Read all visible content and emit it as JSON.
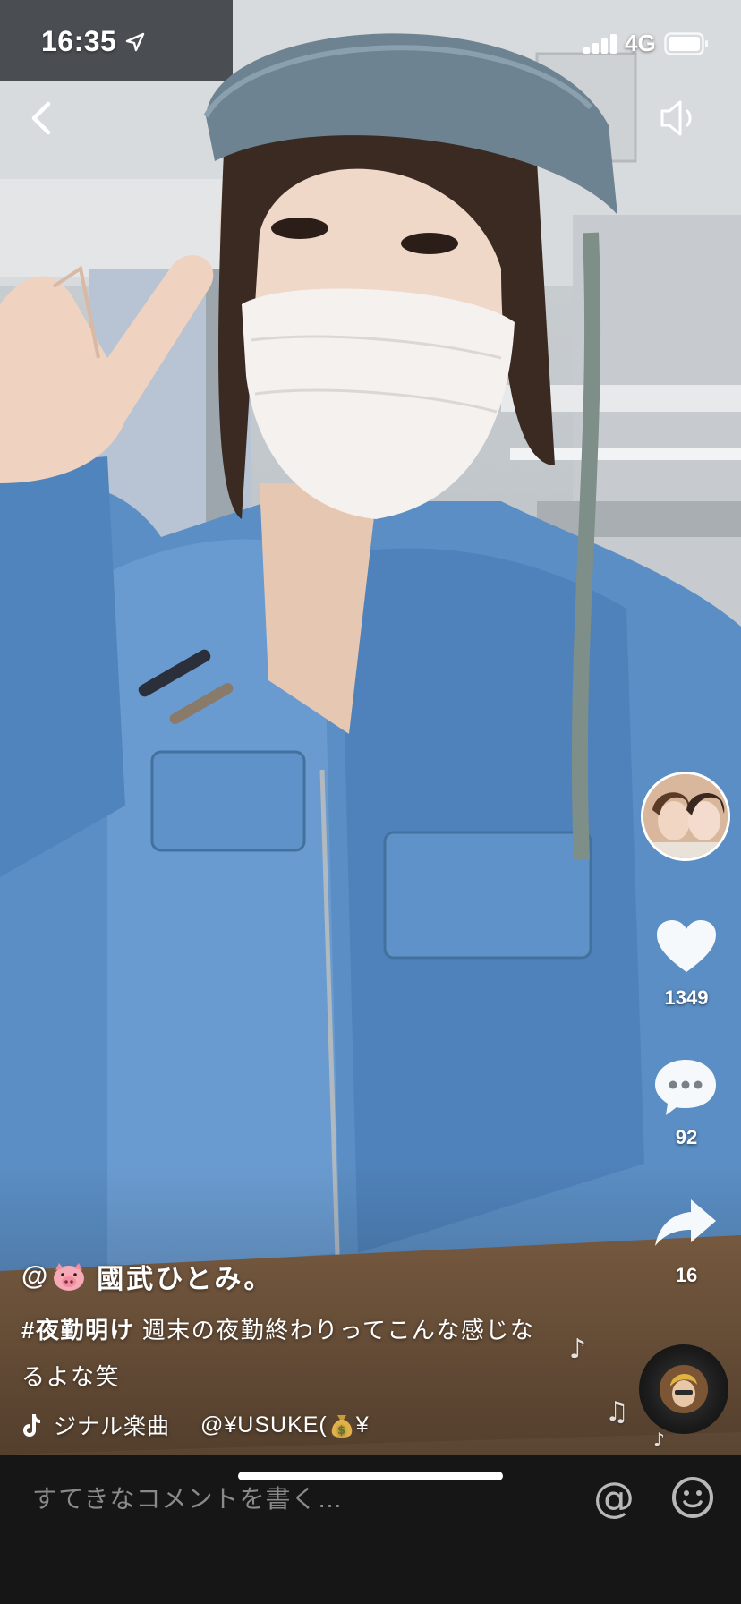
{
  "status_bar": {
    "time": "16:35",
    "network": "4G",
    "icons": [
      "location-arrow-icon",
      "cellular-signal-icon",
      "battery-icon"
    ]
  },
  "top_bar": {
    "icons": [
      "back-chevron-icon",
      "speaker-icon"
    ]
  },
  "actions": {
    "likes": "1349",
    "comments": "92",
    "shares": "16",
    "icons": [
      "heart-icon",
      "comment-bubble-icon",
      "share-arrow-icon"
    ]
  },
  "caption": {
    "at_sign": "@",
    "username": "國武ひとみ。",
    "hashtag": "#夜勤明け",
    "text_line1": "週末の夜勤終わりってこんな感じな",
    "text_line2": "るよな笑",
    "music_title": "ジナル楽曲",
    "music_author_prefix": "@¥USUKE(",
    "music_author_suffix": "¥"
  },
  "comment_bar": {
    "placeholder": "すてきなコメントを書く…",
    "mention_symbol": "@"
  },
  "colors": {
    "background": "#000000",
    "comment_bar": "#161616",
    "placeholder": "#8a8a8a",
    "uniform_blue": "#5b8ec4"
  }
}
